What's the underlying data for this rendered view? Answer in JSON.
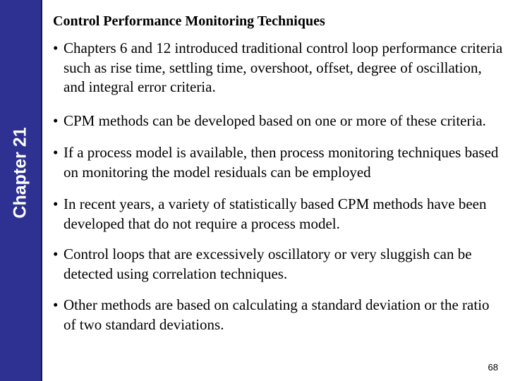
{
  "sidebar": {
    "label": "Chapter 21",
    "color": "#2E3192"
  },
  "slide": {
    "title": "Control Performance Monitoring Techniques",
    "bullet_glyph": "•",
    "bullets": [
      "Chapters 6 and 12 introduced traditional control loop performance criteria such as rise time, settling time, overshoot, offset, degree of oscillation, and integral error criteria.",
      "CPM methods can be developed based on one or more of these criteria.",
      "If a process model is available, then process monitoring techniques based on monitoring the model residuals can be employed",
      "In recent years, a variety of statistically based CPM methods have been developed that do not require a process model.",
      "Control loops that are excessively oscillatory or very sluggish can be detected using correlation techniques.",
      "Other methods are based on calculating a standard deviation or the ratio of two standard deviations."
    ],
    "page_number": "68"
  }
}
